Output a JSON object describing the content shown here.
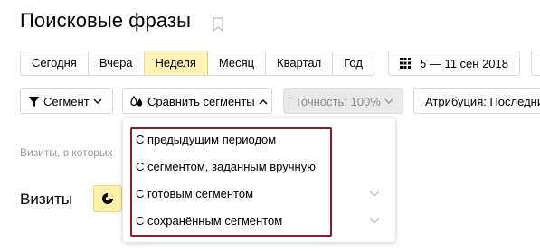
{
  "page": {
    "title": "Поисковые фразы"
  },
  "periods": [
    {
      "label": "Сегодня",
      "active": false
    },
    {
      "label": "Вчера",
      "active": false
    },
    {
      "label": "Неделя",
      "active": true
    },
    {
      "label": "Месяц",
      "active": false
    },
    {
      "label": "Квартал",
      "active": false
    },
    {
      "label": "Год",
      "active": false
    }
  ],
  "date_range": {
    "label": "5 — 11 сен 2018"
  },
  "filters": {
    "segment_label": "Сегмент",
    "compare_label": "Сравнить сегменты",
    "accuracy_label": "Точность: 100%",
    "attribution_label": "Атрибуция: Последний"
  },
  "content": {
    "note": "Визиты, в которых",
    "visits_label": "Визиты"
  },
  "dropdown": {
    "items": [
      {
        "label": "С предыдущим периодом",
        "has_submenu": false
      },
      {
        "label": "С сегментом, заданным вручную",
        "has_submenu": false
      },
      {
        "label": "С готовым сегментом",
        "has_submenu": true
      },
      {
        "label": "С сохранённым сегментом",
        "has_submenu": true
      }
    ]
  },
  "colors": {
    "active_period_bg": "#fff2b3",
    "highlight_border": "#8b1c28",
    "disabled_bg": "#e9e9e9"
  },
  "icons": {
    "bookmark": "bookmark-icon",
    "calendar": "grid-dots-icon",
    "segment": "funnel-icon",
    "compare": "drops-icon",
    "chart_type": "pie-chart-icon"
  }
}
